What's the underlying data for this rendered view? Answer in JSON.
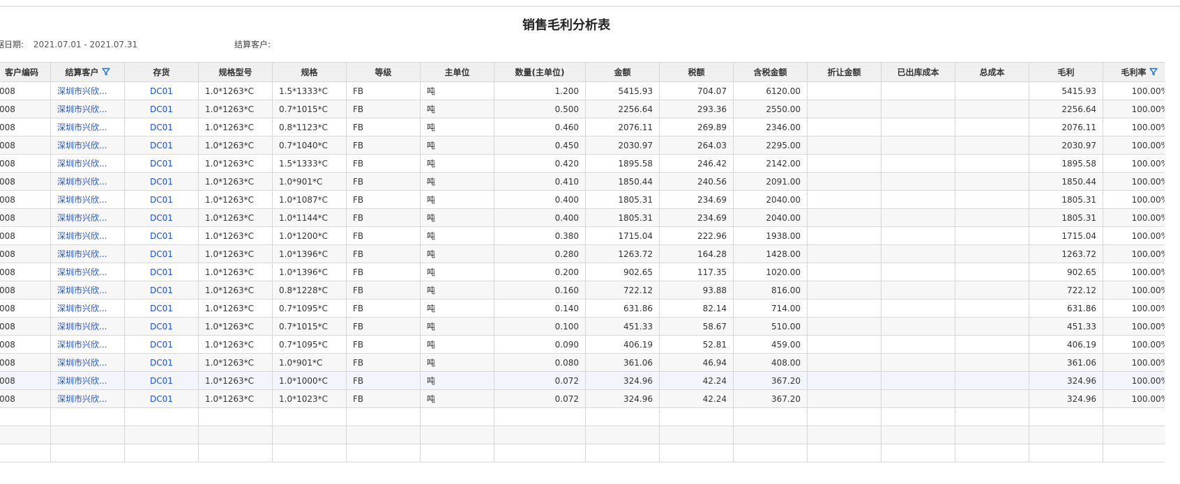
{
  "report": {
    "title": "销售毛利分析表",
    "date_label": "据日期:",
    "date_value": "2021.07.01 - 2021.07.31",
    "customer_label": "结算客户:",
    "customer_value": ""
  },
  "columns": [
    "客户编码",
    "结算客户",
    "存货",
    "规格型号",
    "规格",
    "等级",
    "主单位",
    "数量(主单位)",
    "金额",
    "税额",
    "含税金额",
    "折让金额",
    "已出库成本",
    "总成本",
    "毛利",
    "毛利率"
  ],
  "filter_icon": "filter-icon",
  "accent_color": "#1e50d2",
  "rows": [
    {
      "code": "008",
      "customer": "深圳市兴欣...",
      "item": "DC01",
      "model": "1.0*1263*C",
      "spec": "1.5*1333*C",
      "grade": "FB",
      "unit": "吨",
      "qty": "1.200",
      "amount": "5415.93",
      "tax": "704.07",
      "total": "6120.00",
      "discount": "",
      "shipped_cost": "",
      "total_cost": "",
      "profit": "5415.93",
      "margin": "100.00%"
    },
    {
      "code": "008",
      "customer": "深圳市兴欣...",
      "item": "DC01",
      "model": "1.0*1263*C",
      "spec": "0.7*1015*C",
      "grade": "FB",
      "unit": "吨",
      "qty": "0.500",
      "amount": "2256.64",
      "tax": "293.36",
      "total": "2550.00",
      "discount": "",
      "shipped_cost": "",
      "total_cost": "",
      "profit": "2256.64",
      "margin": "100.00%"
    },
    {
      "code": "008",
      "customer": "深圳市兴欣...",
      "item": "DC01",
      "model": "1.0*1263*C",
      "spec": "0.8*1123*C",
      "grade": "FB",
      "unit": "吨",
      "qty": "0.460",
      "amount": "2076.11",
      "tax": "269.89",
      "total": "2346.00",
      "discount": "",
      "shipped_cost": "",
      "total_cost": "",
      "profit": "2076.11",
      "margin": "100.00%"
    },
    {
      "code": "008",
      "customer": "深圳市兴欣...",
      "item": "DC01",
      "model": "1.0*1263*C",
      "spec": "0.7*1040*C",
      "grade": "FB",
      "unit": "吨",
      "qty": "0.450",
      "amount": "2030.97",
      "tax": "264.03",
      "total": "2295.00",
      "discount": "",
      "shipped_cost": "",
      "total_cost": "",
      "profit": "2030.97",
      "margin": "100.00%"
    },
    {
      "code": "008",
      "customer": "深圳市兴欣...",
      "item": "DC01",
      "model": "1.0*1263*C",
      "spec": "1.5*1333*C",
      "grade": "FB",
      "unit": "吨",
      "qty": "0.420",
      "amount": "1895.58",
      "tax": "246.42",
      "total": "2142.00",
      "discount": "",
      "shipped_cost": "",
      "total_cost": "",
      "profit": "1895.58",
      "margin": "100.00%"
    },
    {
      "code": "008",
      "customer": "深圳市兴欣...",
      "item": "DC01",
      "model": "1.0*1263*C",
      "spec": "1.0*901*C",
      "grade": "FB",
      "unit": "吨",
      "qty": "0.410",
      "amount": "1850.44",
      "tax": "240.56",
      "total": "2091.00",
      "discount": "",
      "shipped_cost": "",
      "total_cost": "",
      "profit": "1850.44",
      "margin": "100.00%"
    },
    {
      "code": "008",
      "customer": "深圳市兴欣...",
      "item": "DC01",
      "model": "1.0*1263*C",
      "spec": "1.0*1087*C",
      "grade": "FB",
      "unit": "吨",
      "qty": "0.400",
      "amount": "1805.31",
      "tax": "234.69",
      "total": "2040.00",
      "discount": "",
      "shipped_cost": "",
      "total_cost": "",
      "profit": "1805.31",
      "margin": "100.00%"
    },
    {
      "code": "008",
      "customer": "深圳市兴欣...",
      "item": "DC01",
      "model": "1.0*1263*C",
      "spec": "1.0*1144*C",
      "grade": "FB",
      "unit": "吨",
      "qty": "0.400",
      "amount": "1805.31",
      "tax": "234.69",
      "total": "2040.00",
      "discount": "",
      "shipped_cost": "",
      "total_cost": "",
      "profit": "1805.31",
      "margin": "100.00%"
    },
    {
      "code": "008",
      "customer": "深圳市兴欣...",
      "item": "DC01",
      "model": "1.0*1263*C",
      "spec": "1.0*1200*C",
      "grade": "FB",
      "unit": "吨",
      "qty": "0.380",
      "amount": "1715.04",
      "tax": "222.96",
      "total": "1938.00",
      "discount": "",
      "shipped_cost": "",
      "total_cost": "",
      "profit": "1715.04",
      "margin": "100.00%"
    },
    {
      "code": "008",
      "customer": "深圳市兴欣...",
      "item": "DC01",
      "model": "1.0*1263*C",
      "spec": "1.0*1396*C",
      "grade": "FB",
      "unit": "吨",
      "qty": "0.280",
      "amount": "1263.72",
      "tax": "164.28",
      "total": "1428.00",
      "discount": "",
      "shipped_cost": "",
      "total_cost": "",
      "profit": "1263.72",
      "margin": "100.00%"
    },
    {
      "code": "008",
      "customer": "深圳市兴欣...",
      "item": "DC01",
      "model": "1.0*1263*C",
      "spec": "1.0*1396*C",
      "grade": "FB",
      "unit": "吨",
      "qty": "0.200",
      "amount": "902.65",
      "tax": "117.35",
      "total": "1020.00",
      "discount": "",
      "shipped_cost": "",
      "total_cost": "",
      "profit": "902.65",
      "margin": "100.00%"
    },
    {
      "code": "008",
      "customer": "深圳市兴欣...",
      "item": "DC01",
      "model": "1.0*1263*C",
      "spec": "0.8*1228*C",
      "grade": "FB",
      "unit": "吨",
      "qty": "0.160",
      "amount": "722.12",
      "tax": "93.88",
      "total": "816.00",
      "discount": "",
      "shipped_cost": "",
      "total_cost": "",
      "profit": "722.12",
      "margin": "100.00%"
    },
    {
      "code": "008",
      "customer": "深圳市兴欣...",
      "item": "DC01",
      "model": "1.0*1263*C",
      "spec": "0.7*1095*C",
      "grade": "FB",
      "unit": "吨",
      "qty": "0.140",
      "amount": "631.86",
      "tax": "82.14",
      "total": "714.00",
      "discount": "",
      "shipped_cost": "",
      "total_cost": "",
      "profit": "631.86",
      "margin": "100.00%"
    },
    {
      "code": "008",
      "customer": "深圳市兴欣...",
      "item": "DC01",
      "model": "1.0*1263*C",
      "spec": "0.7*1015*C",
      "grade": "FB",
      "unit": "吨",
      "qty": "0.100",
      "amount": "451.33",
      "tax": "58.67",
      "total": "510.00",
      "discount": "",
      "shipped_cost": "",
      "total_cost": "",
      "profit": "451.33",
      "margin": "100.00%"
    },
    {
      "code": "008",
      "customer": "深圳市兴欣...",
      "item": "DC01",
      "model": "1.0*1263*C",
      "spec": "0.7*1095*C",
      "grade": "FB",
      "unit": "吨",
      "qty": "0.090",
      "amount": "406.19",
      "tax": "52.81",
      "total": "459.00",
      "discount": "",
      "shipped_cost": "",
      "total_cost": "",
      "profit": "406.19",
      "margin": "100.00%"
    },
    {
      "code": "008",
      "customer": "深圳市兴欣...",
      "item": "DC01",
      "model": "1.0*1263*C",
      "spec": "1.0*901*C",
      "grade": "FB",
      "unit": "吨",
      "qty": "0.080",
      "amount": "361.06",
      "tax": "46.94",
      "total": "408.00",
      "discount": "",
      "shipped_cost": "",
      "total_cost": "",
      "profit": "361.06",
      "margin": "100.00%"
    },
    {
      "code": "008",
      "customer": "深圳市兴欣...",
      "item": "DC01",
      "model": "1.0*1263*C",
      "spec": "1.0*1000*C",
      "grade": "FB",
      "unit": "吨",
      "qty": "0.072",
      "amount": "324.96",
      "tax": "42.24",
      "total": "367.20",
      "discount": "",
      "shipped_cost": "",
      "total_cost": "",
      "profit": "324.96",
      "margin": "100.00%"
    },
    {
      "code": "008",
      "customer": "深圳市兴欣...",
      "item": "DC01",
      "model": "1.0*1263*C",
      "spec": "1.0*1023*C",
      "grade": "FB",
      "unit": "吨",
      "qty": "0.072",
      "amount": "324.96",
      "tax": "42.24",
      "total": "367.20",
      "discount": "",
      "shipped_cost": "",
      "total_cost": "",
      "profit": "324.96",
      "margin": "100.00%"
    }
  ]
}
